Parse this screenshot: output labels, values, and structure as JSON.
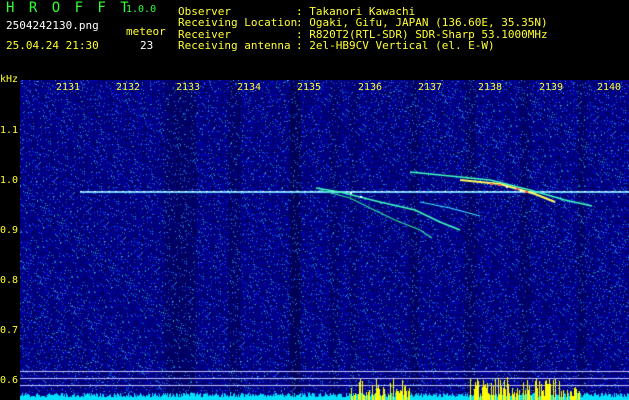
{
  "app": {
    "name": "H R O F F T",
    "version": "1.0.0"
  },
  "file": {
    "name": "2504242130.png",
    "datetime": "25.04.24 21:30"
  },
  "detection": {
    "label": "meteor",
    "count": "23"
  },
  "info": [
    {
      "label": "Observer",
      "value": ": Takanori Kawachi"
    },
    {
      "label": "Receiving Location",
      "value": ": Ogaki, Gifu, JAPAN (136.60E, 35.35N)"
    },
    {
      "label": "Receiver",
      "value": ": R820T2(RTL-SDR) SDR-Sharp 53.1000MHz"
    },
    {
      "label": "Receiving antenna",
      "value": ": 2el-HB9CV Vertical (el. E-W)"
    }
  ],
  "colors": {
    "label": "#ffff33",
    "title": "#33ff33",
    "background": "#000080",
    "trace": "#40ffc0",
    "baseline": "#00ffff"
  },
  "chart_data": {
    "type": "heatmap",
    "ylabel": "kHz",
    "x_ticks": [
      "2131",
      "2132",
      "2133",
      "2134",
      "2135",
      "2136",
      "2137",
      "2138",
      "2139",
      "2140"
    ],
    "y_ticks": [
      "1.1",
      "1.0",
      "0.9",
      "0.8",
      "0.7",
      "0.6"
    ]
  }
}
